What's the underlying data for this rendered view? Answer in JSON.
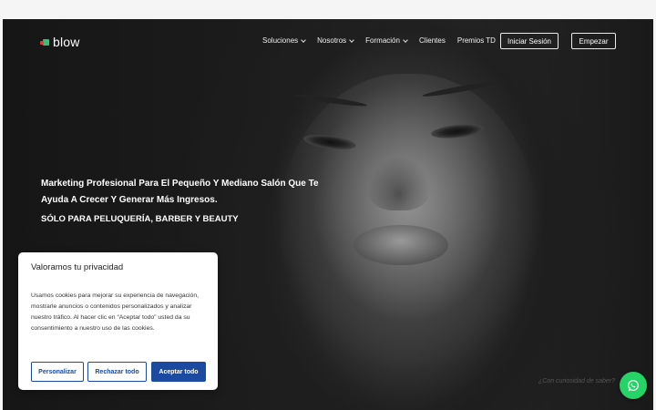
{
  "nav": {
    "logo_text": "blow",
    "menu": [
      {
        "label": "Soluciones",
        "has_dropdown": true
      },
      {
        "label": "Nosotros",
        "has_dropdown": true
      },
      {
        "label": "Formación",
        "has_dropdown": true
      },
      {
        "label": "Clientes",
        "has_dropdown": false
      },
      {
        "label": "Premios TD",
        "has_dropdown": false
      }
    ],
    "login_label": "Iniciar Sesión",
    "start_label": "Empezar"
  },
  "hero": {
    "headline": "Marketing Profesional Para El Pequeño Y Mediano Salón Que Te Ayuda A Crecer Y Generar Más Ingresos.",
    "subheadline": "SÓLO PARA PELUQUERÍA, BARBER Y BEAUTY",
    "watermark": "¿Con curiosidad de saber?"
  },
  "cookie_banner": {
    "title": "Valoramos tu privacidad",
    "text": "Usamos cookies para mejorar su experiencia de navegación, mostrarle anuncios o contenidos personalizados y analizar nuestro tráfico. Al hacer clic en “Aceptar todo” usted da su consentimiento a nuestro uso de las cookies.",
    "customize_label": "Personalizar",
    "reject_label": "Rechazar todo",
    "accept_label": "Aceptar todo"
  },
  "colors": {
    "accent": "#1b4aa0",
    "whatsapp": "#25d366"
  },
  "icons": {
    "whatsapp": "whatsapp-icon",
    "dropdown": "chevron-down-icon"
  }
}
